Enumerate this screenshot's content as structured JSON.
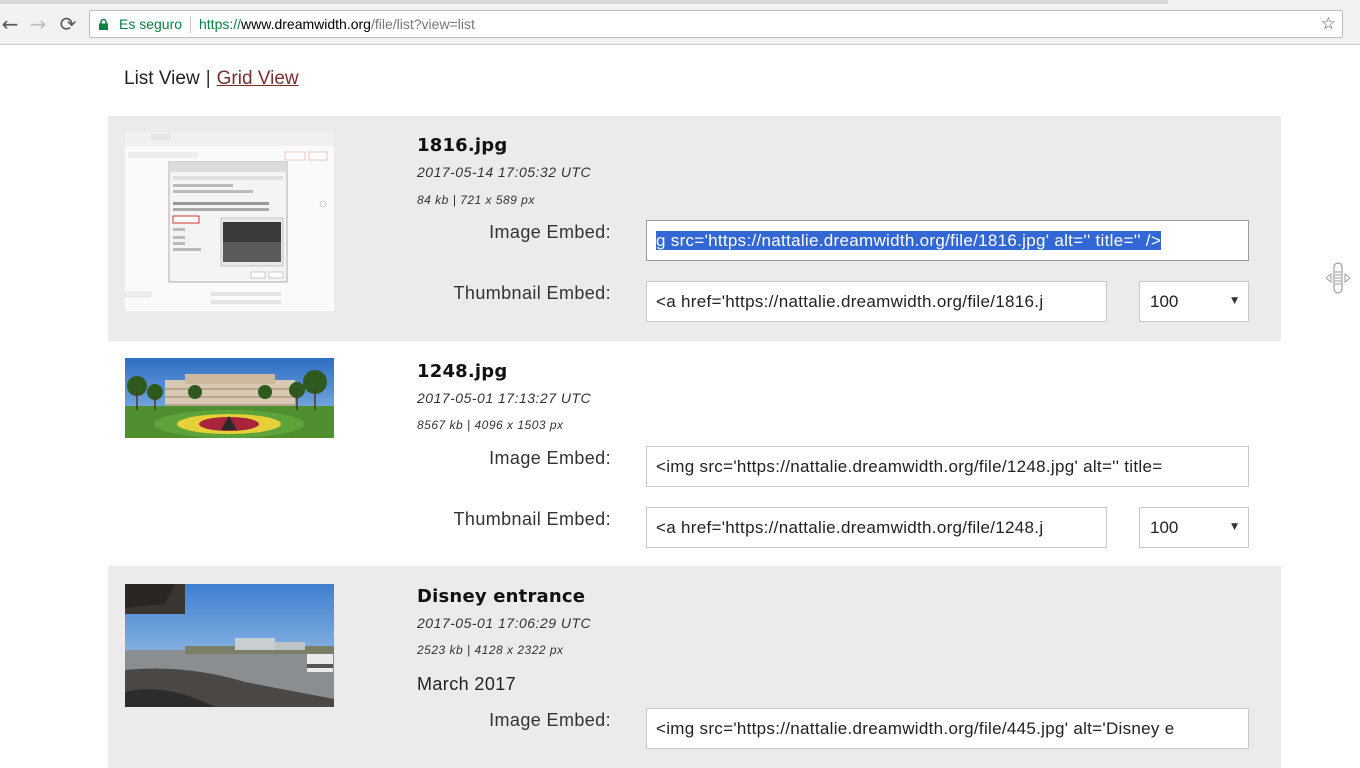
{
  "browser": {
    "secure_label": "Es seguro",
    "url_scheme": "https://",
    "url_host": "www.dreamwidth.org",
    "url_path": "/file/list?view=list"
  },
  "view_switch": {
    "current": "List View",
    "separator": "|",
    "link": "Grid View"
  },
  "labels": {
    "image_embed": "Image Embed:",
    "thumbnail_embed": "Thumbnail Embed:"
  },
  "files": [
    {
      "name": "1816.jpg",
      "date": "2017-05-14 17:05:32 UTC",
      "meta": "84 kb | 721 x 589 px",
      "image_embed": "g src='https://nattalie.dreamwidth.org/file/1816.jpg' alt='' title='' />",
      "thumbnail_embed": "<a href='https://nattalie.dreamwidth.org/file/1816.j",
      "thumb_size": "100"
    },
    {
      "name": "1248.jpg",
      "date": "2017-05-01 17:13:27 UTC",
      "meta": "8567 kb | 4096 x 1503 px",
      "image_embed": "<img src='https://nattalie.dreamwidth.org/file/1248.jpg' alt='' title=",
      "thumbnail_embed": "<a href='https://nattalie.dreamwidth.org/file/1248.j",
      "thumb_size": "100"
    },
    {
      "name": "Disney entrance",
      "date": "2017-05-01 17:06:29 UTC",
      "meta": "2523 kb | 4128 x 2322 px",
      "description": "March 2017",
      "image_embed": "<img src='https://nattalie.dreamwidth.org/file/445.jpg' alt='Disney e"
    }
  ],
  "colors": {
    "row_shade": "#ebebeb",
    "link": "#7a2f2f",
    "selection": "#3367d6",
    "secure": "#0b8043"
  }
}
